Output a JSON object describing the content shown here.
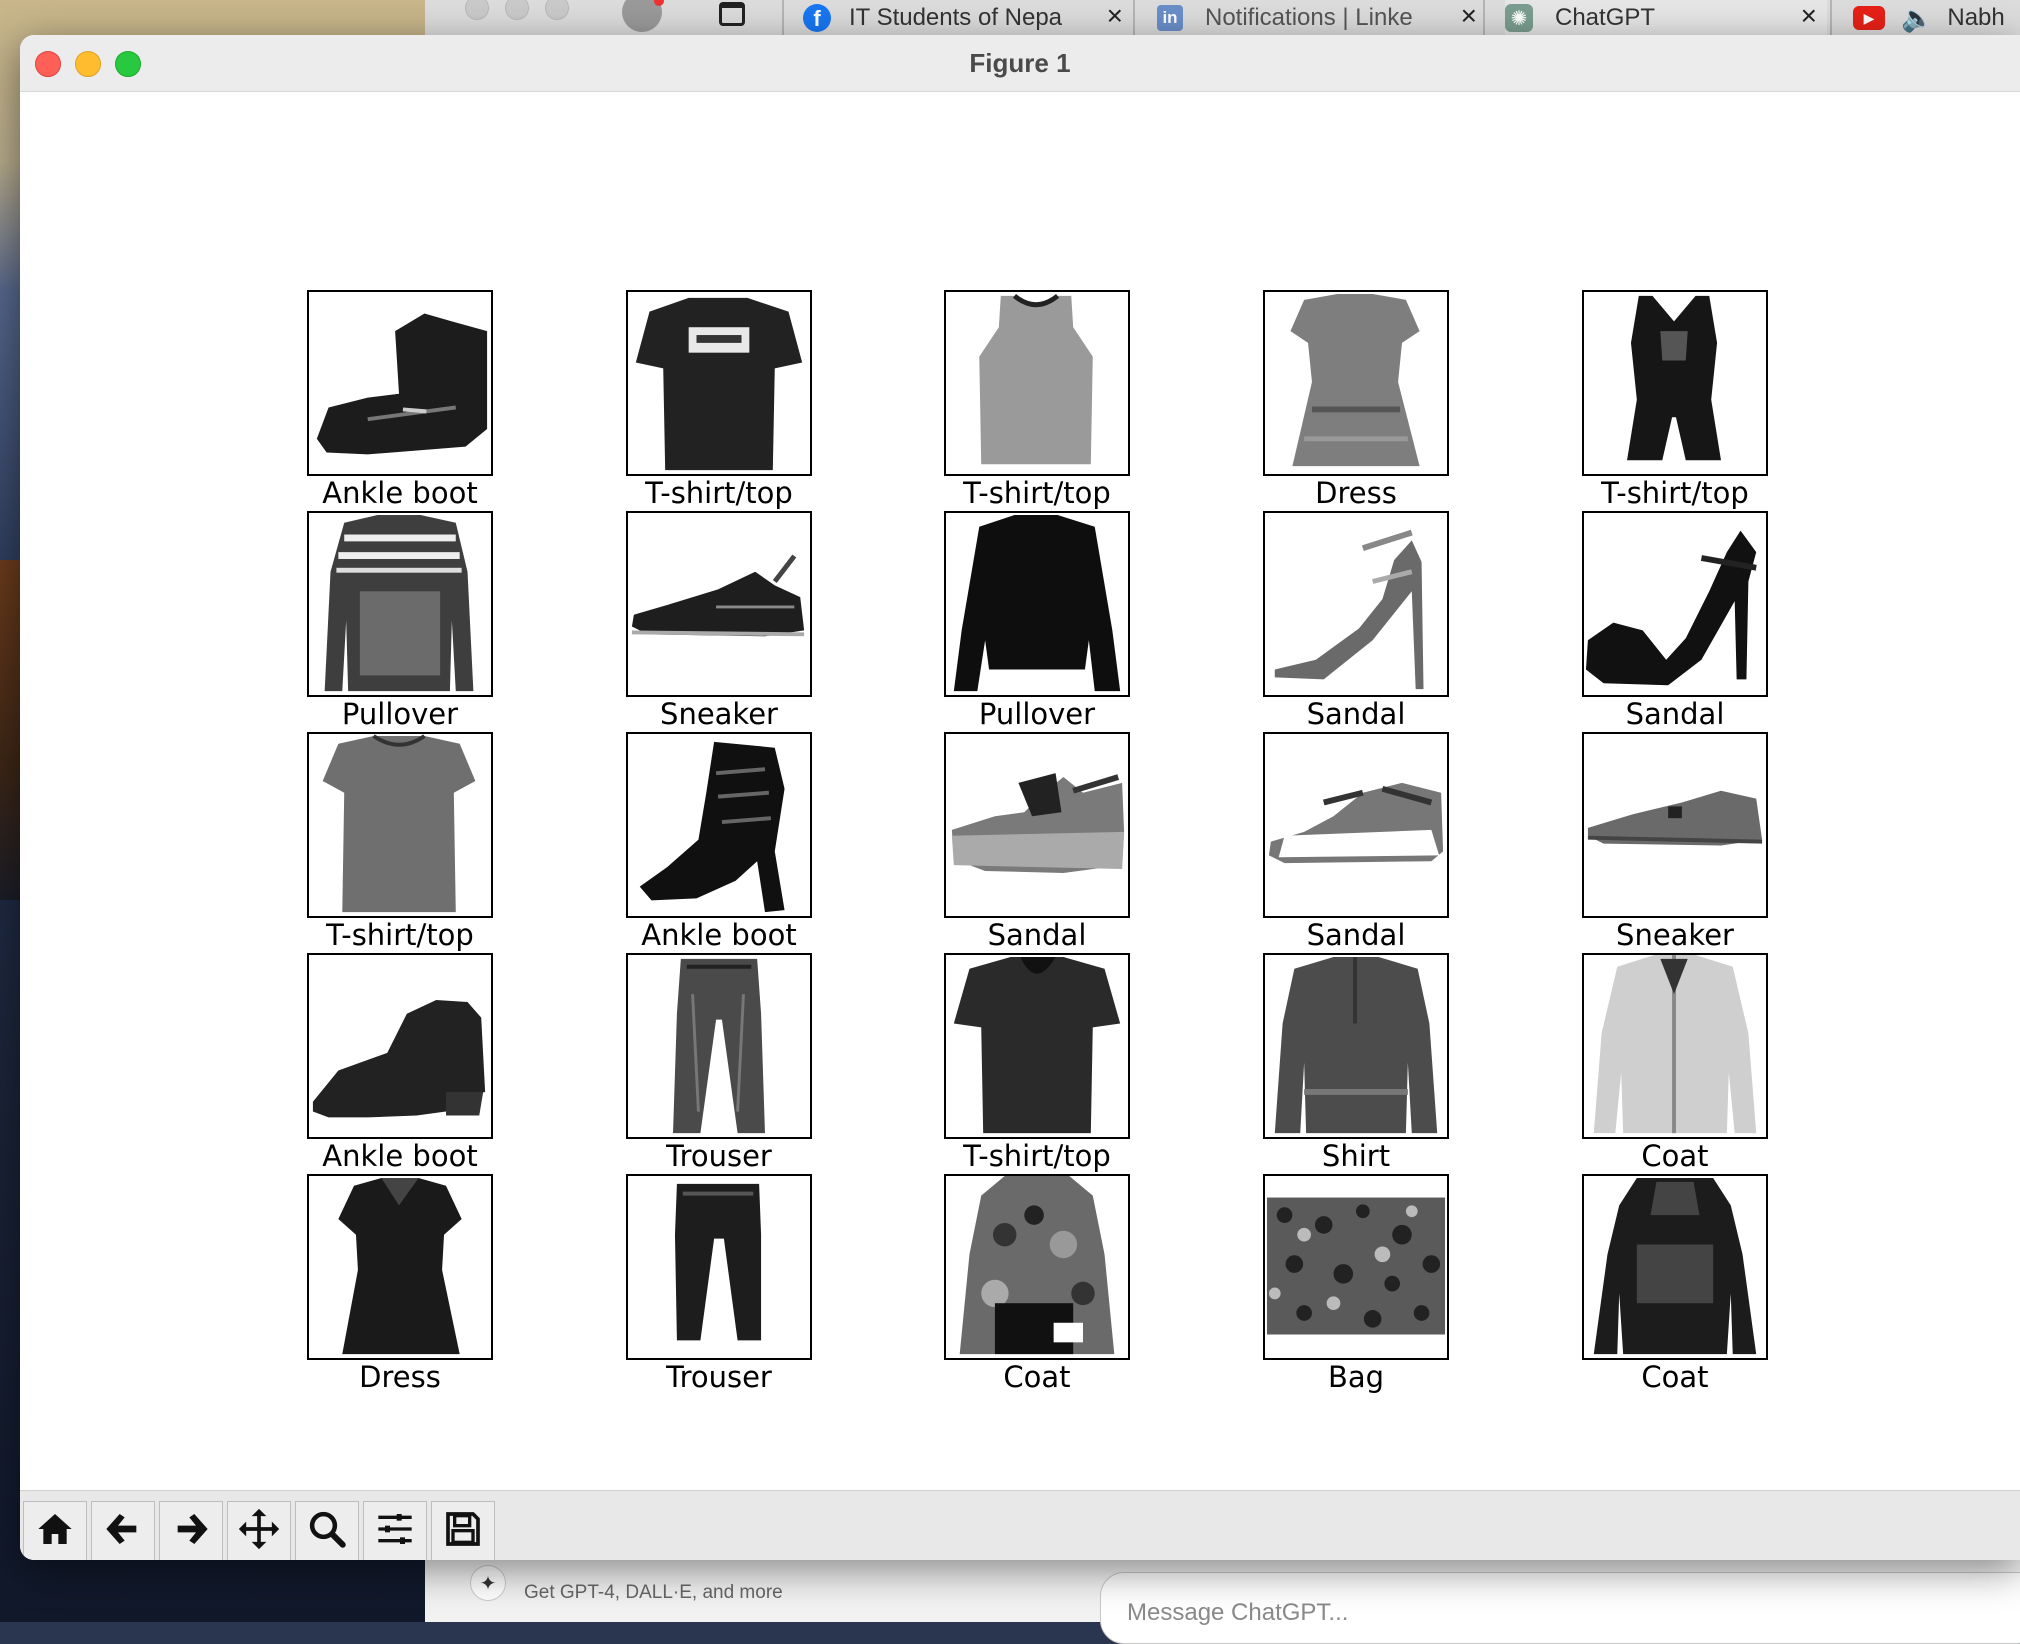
{
  "browser": {
    "tabs": [
      {
        "label": "IT Students of Nepa",
        "icon": "facebook-icon"
      },
      {
        "label": "Notifications | Linke",
        "icon": "linkedin-icon"
      },
      {
        "label": "ChatGPT",
        "icon": "chatgpt-icon"
      },
      {
        "label": "Nabh",
        "icon": "youtube-icon"
      }
    ],
    "close_glyph": "×"
  },
  "behind_page": {
    "promo_text": "Get GPT-4, DALL·E, and more",
    "message_placeholder": "Message ChatGPT..."
  },
  "window": {
    "title": "Figure 1"
  },
  "figure": {
    "grid": {
      "rows": 5,
      "cols": 5
    },
    "cmap": "binary",
    "items": [
      {
        "label": "Ankle boot",
        "kind": "boot"
      },
      {
        "label": "T-shirt/top",
        "kind": "tshirt_print"
      },
      {
        "label": "T-shirt/top",
        "kind": "tank"
      },
      {
        "label": "Dress",
        "kind": "dress_light"
      },
      {
        "label": "T-shirt/top",
        "kind": "romper"
      },
      {
        "label": "Pullover",
        "kind": "pullover_striped"
      },
      {
        "label": "Sneaker",
        "kind": "sneaker_dark"
      },
      {
        "label": "Pullover",
        "kind": "pullover_dark"
      },
      {
        "label": "Sandal",
        "kind": "sandal_heel_light"
      },
      {
        "label": "Sandal",
        "kind": "sandal_heel_dark"
      },
      {
        "label": "T-shirt/top",
        "kind": "tshirt_long"
      },
      {
        "label": "Ankle boot",
        "kind": "boot_heel"
      },
      {
        "label": "Sandal",
        "kind": "sandal_wedge"
      },
      {
        "label": "Sandal",
        "kind": "sandal_flat"
      },
      {
        "label": "Sneaker",
        "kind": "sneaker_light"
      },
      {
        "label": "Ankle boot",
        "kind": "bootie"
      },
      {
        "label": "Trouser",
        "kind": "trouser_light"
      },
      {
        "label": "T-shirt/top",
        "kind": "tshirt_plain"
      },
      {
        "label": "Shirt",
        "kind": "shirt"
      },
      {
        "label": "Coat",
        "kind": "coat_light"
      },
      {
        "label": "Dress",
        "kind": "dress_dark"
      },
      {
        "label": "Trouser",
        "kind": "trouser_dark"
      },
      {
        "label": "Coat",
        "kind": "coat_camo"
      },
      {
        "label": "Bag",
        "kind": "bag"
      },
      {
        "label": "Coat",
        "kind": "coat_hood"
      }
    ]
  },
  "toolbar": {
    "buttons": [
      {
        "name": "home-button",
        "icon": "home-icon"
      },
      {
        "name": "back-button",
        "icon": "arrow-left-icon"
      },
      {
        "name": "forward-button",
        "icon": "arrow-right-icon"
      },
      {
        "name": "pan-button",
        "icon": "move-icon"
      },
      {
        "name": "zoom-button",
        "icon": "magnifier-icon"
      },
      {
        "name": "configure-subplots-button",
        "icon": "sliders-icon"
      },
      {
        "name": "save-button",
        "icon": "floppy-icon"
      }
    ]
  }
}
